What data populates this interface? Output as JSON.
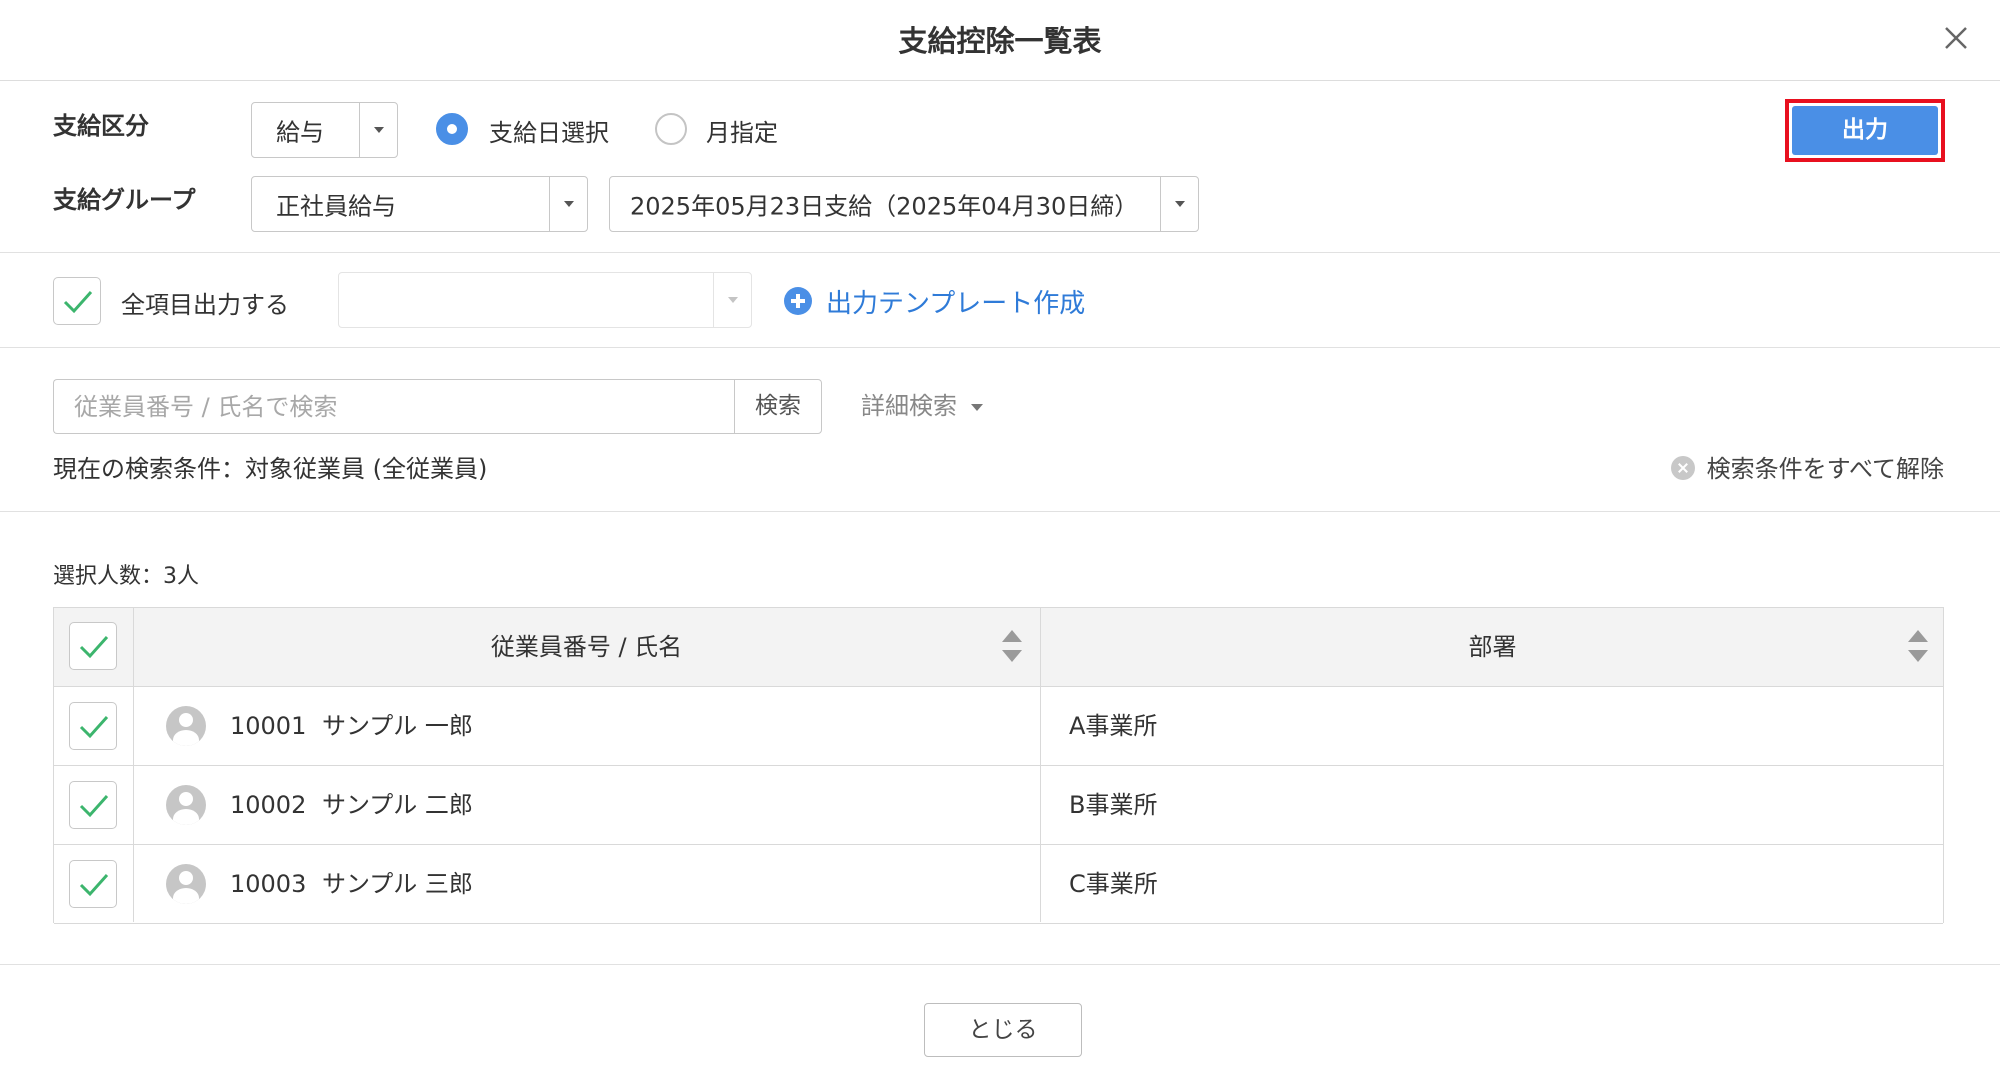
{
  "dialog": {
    "title": "支給控除一覧表",
    "close_icon": "close-icon"
  },
  "form": {
    "pay_type_label": "支給区分",
    "pay_type_value": "給与",
    "radio_pay_date_label": "支給日選択",
    "radio_month_label": "月指定",
    "radio_selected": "支給日選択",
    "pay_group_label": "支給グループ",
    "pay_group_value": "正社員給与",
    "pay_date_value": "2025年05月23日支給（2025年04月30日締）",
    "output_button": "出力",
    "output_highlight_color": "#e8101f",
    "accent_color": "#4a8fe6"
  },
  "template": {
    "all_items_label": "全項目出力する",
    "all_items_checked": true,
    "template_select_value": "",
    "create_template_link": "出力テンプレート作成"
  },
  "search": {
    "placeholder": "従業員番号 / 氏名で検索",
    "button": "検索",
    "detail_search": "詳細検索",
    "current_condition": "現在の検索条件：対象従業員 (全従業員)",
    "clear_all": "検索条件をすべて解除"
  },
  "table": {
    "selected_count": "選択人数：3人",
    "columns": [
      "従業員番号 / 氏名",
      "部署"
    ],
    "header_checked": true,
    "rows": [
      {
        "employee_no": "10001",
        "name": "サンプル 一郎",
        "department": "A事業所",
        "checked": true
      },
      {
        "employee_no": "10002",
        "name": "サンプル 二郎",
        "department": "B事業所",
        "checked": true
      },
      {
        "employee_no": "10003",
        "name": "サンプル 三郎",
        "department": "C事業所",
        "checked": true
      }
    ]
  },
  "footer": {
    "close_button": "とじる"
  }
}
